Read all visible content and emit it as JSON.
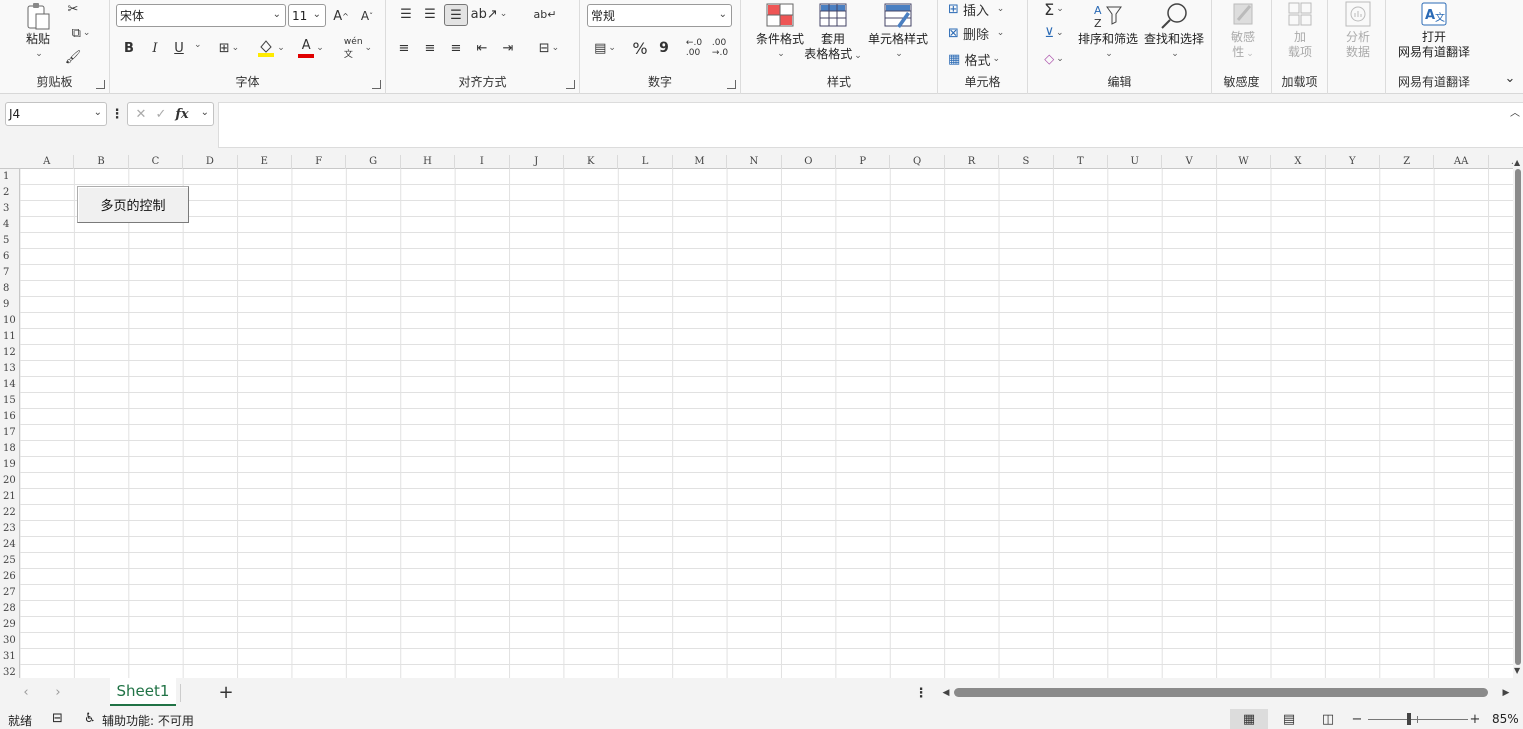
{
  "ribbon": {
    "clipboard": {
      "label": "剪贴板",
      "paste": "粘贴"
    },
    "font": {
      "label": "字体",
      "name": "宋体",
      "size": "11",
      "bold": "B",
      "italic": "I",
      "underline": "U",
      "font_color": "A"
    },
    "alignment": {
      "label": "对齐方式"
    },
    "number": {
      "label": "数字",
      "format": "常规",
      "percent": "%",
      "comma": "9"
    },
    "styles": {
      "label": "样式",
      "conditional": "条件格式",
      "table_format_1": "套用",
      "table_format_2": "表格格式",
      "cell_styles": "单元格样式"
    },
    "cells": {
      "label": "单元格",
      "insert": "插入",
      "delete": "删除",
      "format": "格式"
    },
    "editing": {
      "label": "编辑",
      "sigma": "Σ",
      "sort": "排序和筛选",
      "find": "查找和选择"
    },
    "sensitivity": {
      "label": "敏感度",
      "btn1": "敏感",
      "btn2": "性"
    },
    "addins": {
      "label": "加载项",
      "btn1": "加",
      "btn2": "载项"
    },
    "analysis": {
      "btn1": "分析",
      "btn2": "数据"
    },
    "youdao": {
      "label": "网易有道翻译",
      "btn1": "打开",
      "btn2": "网易有道翻译"
    }
  },
  "formula_bar": {
    "name_box": "J4",
    "fx": "fx",
    "value": ""
  },
  "sheet": {
    "columns": [
      "A",
      "B",
      "C",
      "D",
      "E",
      "F",
      "G",
      "H",
      "I",
      "J",
      "K",
      "L",
      "M",
      "N",
      "O",
      "P",
      "Q",
      "R",
      "S",
      "T",
      "U",
      "V",
      "W",
      "X",
      "Y",
      "Z",
      "AA",
      "A"
    ],
    "rows": [
      "1",
      "2",
      "3",
      "4",
      "5",
      "6",
      "7",
      "8",
      "9",
      "10",
      "11",
      "12",
      "13",
      "14",
      "15",
      "16",
      "17",
      "18",
      "19",
      "20",
      "21",
      "22",
      "23",
      "24",
      "25",
      "26",
      "27",
      "28",
      "29",
      "30",
      "31",
      "32"
    ],
    "form_button": "多页的控制"
  },
  "tabs": {
    "active": "Sheet1",
    "add": "+"
  },
  "status": {
    "ready": "就绪",
    "accessibility": "辅助功能: 不可用",
    "zoom": "85%",
    "zoom_minus": "−",
    "zoom_plus": "+"
  },
  "colors": {
    "accent": "#217346",
    "red": "#e00000",
    "yellow": "#ffeb00"
  }
}
